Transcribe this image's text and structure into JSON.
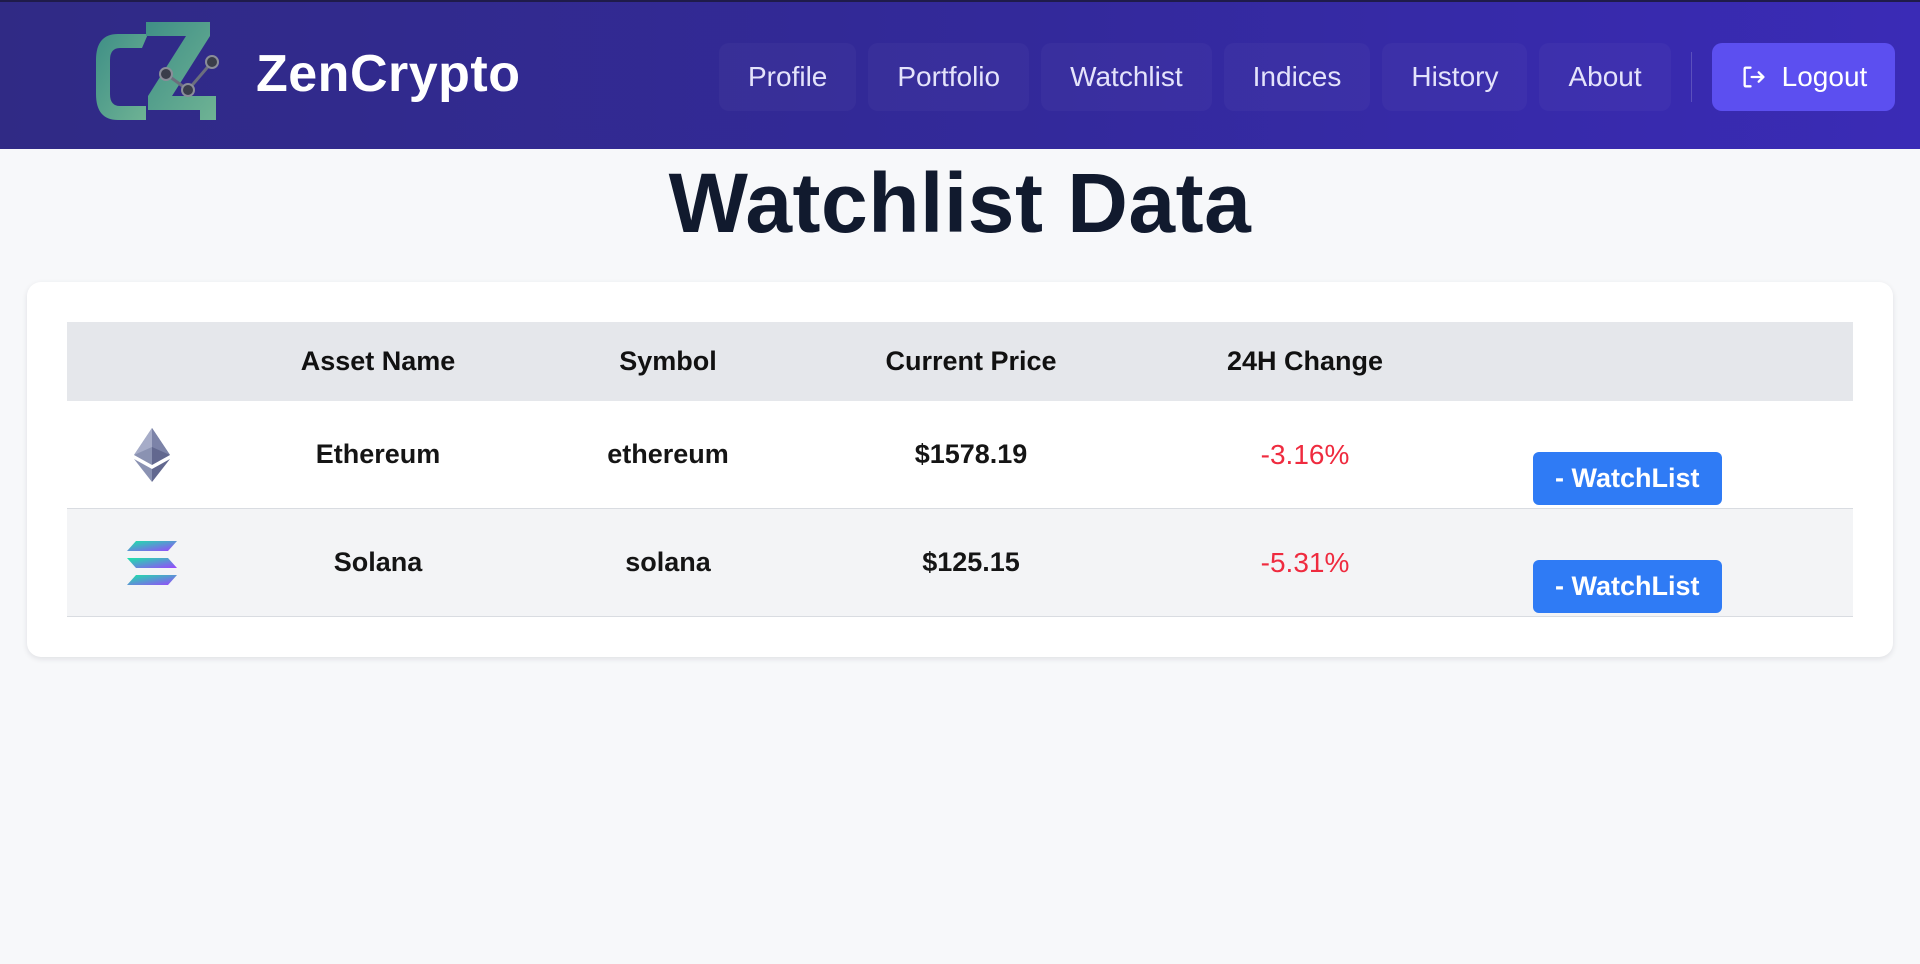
{
  "brand": {
    "name": "ZenCrypto",
    "logo_icon": "zencrypto-logo-icon"
  },
  "nav": {
    "items": [
      {
        "label": "Profile"
      },
      {
        "label": "Portfolio"
      },
      {
        "label": "Watchlist"
      },
      {
        "label": "Indices"
      },
      {
        "label": "History"
      },
      {
        "label": "About"
      }
    ],
    "logout": {
      "label": "Logout",
      "icon": "logout-icon"
    }
  },
  "page": {
    "title": "Watchlist Data"
  },
  "table": {
    "columns": [
      "",
      "Asset Name",
      "Symbol",
      "Current Price",
      "24H Change",
      ""
    ],
    "rows": [
      {
        "icon": "ethereum-icon",
        "name": "Ethereum",
        "symbol": "ethereum",
        "price": "$1578.19",
        "change": "-3.16%",
        "action": "- WatchList"
      },
      {
        "icon": "solana-icon",
        "name": "Solana",
        "symbol": "solana",
        "price": "$125.15",
        "change": "-5.31%",
        "action": "- WatchList"
      }
    ]
  },
  "colors": {
    "nav_bg_start": "#302a85",
    "nav_bg_end": "#3a2bb6",
    "logout_bg": "#5c4ff0",
    "button_blue": "#2f7bf5",
    "negative_change": "#ef2b3f",
    "header_row_bg": "#e5e7eb"
  }
}
